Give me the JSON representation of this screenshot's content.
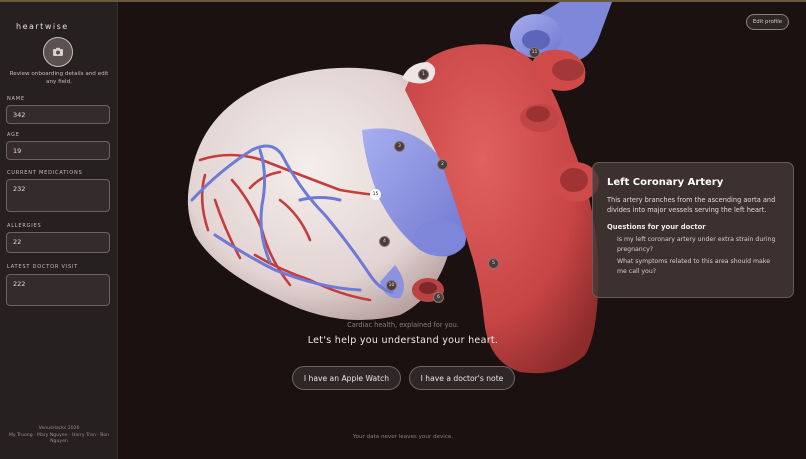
{
  "app": {
    "brand": "heartwise"
  },
  "sidebar": {
    "onboard_text": "Review onboarding details and edit any field.",
    "fields": [
      {
        "label": "NAME",
        "value": "342"
      },
      {
        "label": "AGE",
        "value": "19"
      },
      {
        "label": "CURRENT MEDICATIONS",
        "value": "232"
      },
      {
        "label": "ALLERGIES",
        "value": "22"
      },
      {
        "label": "LATEST DOCTOR VISIT",
        "value": "222"
      }
    ],
    "footer_line1": "VenusHacks 2026",
    "footer_line2": "My Truong · Mary Nguyen · Harry Tran · Bon Nguyen"
  },
  "header": {
    "edit_profile": "Edit profile"
  },
  "info_card": {
    "title": "Left Coronary Artery",
    "description": "This artery branches from the ascending aorta and divides into major vessels serving the left heart.",
    "questions_heading": "Questions for your doctor",
    "questions": [
      "Is my left coronary artery under extra strain during pregnancy?",
      "What symptoms related to this area should make me call you?"
    ]
  },
  "hero": {
    "subtitle": "Cardiac health, explained for you.",
    "headline": "Let's help you understand your heart.",
    "apple_watch_button": "I have an Apple Watch",
    "doctor_note_button": "I have a doctor's note",
    "privacy": "Your data never leaves your device."
  },
  "markers": [
    "1",
    "2",
    "3",
    "4",
    "5",
    "6",
    "10",
    "11",
    "15"
  ],
  "colors": {
    "background": "#1a1110",
    "sidebar": "#262020",
    "heart_red": "#c94848",
    "vessel_blue": "#8a93e0",
    "card": "#463838"
  }
}
